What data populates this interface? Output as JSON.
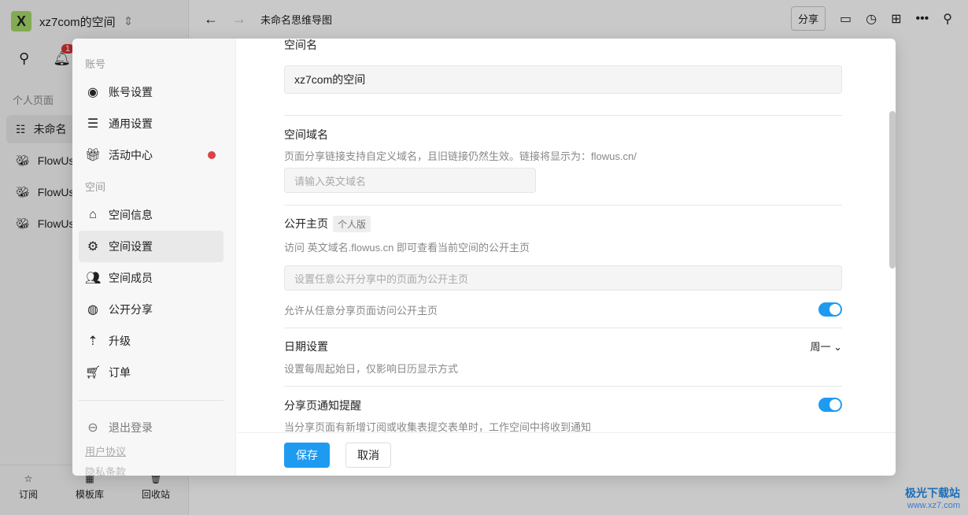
{
  "sidebar": {
    "workspace_initial": "X",
    "workspace_name": "xz7com的空间",
    "notification_count": "1",
    "section": "个人页面",
    "pages": [
      {
        "label": "未命名"
      },
      {
        "label": "FlowUs"
      },
      {
        "label": "FlowUs"
      },
      {
        "label": "FlowUs"
      }
    ],
    "bottom": [
      {
        "label": "订阅",
        "icon": "subscribe-icon"
      },
      {
        "label": "模板库",
        "icon": "template-icon"
      },
      {
        "label": "回收站",
        "icon": "trash-icon"
      }
    ]
  },
  "topbar": {
    "title": "未命名思维导图",
    "share": "分享"
  },
  "modal": {
    "nav": {
      "group_account": "账号",
      "group_space": "空间",
      "items": [
        {
          "label": "账号设置"
        },
        {
          "label": "通用设置"
        },
        {
          "label": "活动中心"
        },
        {
          "label": "空间信息"
        },
        {
          "label": "空间设置"
        },
        {
          "label": "空间成员"
        },
        {
          "label": "公开分享"
        },
        {
          "label": "升级"
        },
        {
          "label": "订单"
        }
      ],
      "logout": "退出登录",
      "user_agreement": "用户协议",
      "privacy": "隐私条款"
    },
    "space_name": {
      "label": "空间名",
      "value": "xz7com的空间"
    },
    "domain": {
      "label": "空间域名",
      "desc": "页面分享链接支持自定义域名，且旧链接仍然生效。链接将显示为：flowus.cn/",
      "placeholder": "请输入英文域名"
    },
    "homepage": {
      "label": "公开主页",
      "tag": "个人版",
      "desc": "访问 英文域名.flowus.cn 即可查看当前空间的公开主页",
      "placeholder": "设置任意公开分享中的页面为公开主页",
      "allow_label": "允许从任意分享页面访问公开主页",
      "allow_enabled": true
    },
    "date": {
      "label": "日期设置",
      "desc": "设置每周起始日，仅影响日历显示方式",
      "value": "周一"
    },
    "notify": {
      "label": "分享页通知提醒",
      "desc": "当分享页面有新增订阅或收集表提交表单时，工作空间中将收到通知",
      "enabled": true
    },
    "save": "保存",
    "cancel": "取消"
  },
  "watermark": {
    "name": "极光下载站",
    "url": "www.xz7.com"
  },
  "colors": {
    "accent": "#1e9bf0",
    "badge": "#d9434a"
  }
}
